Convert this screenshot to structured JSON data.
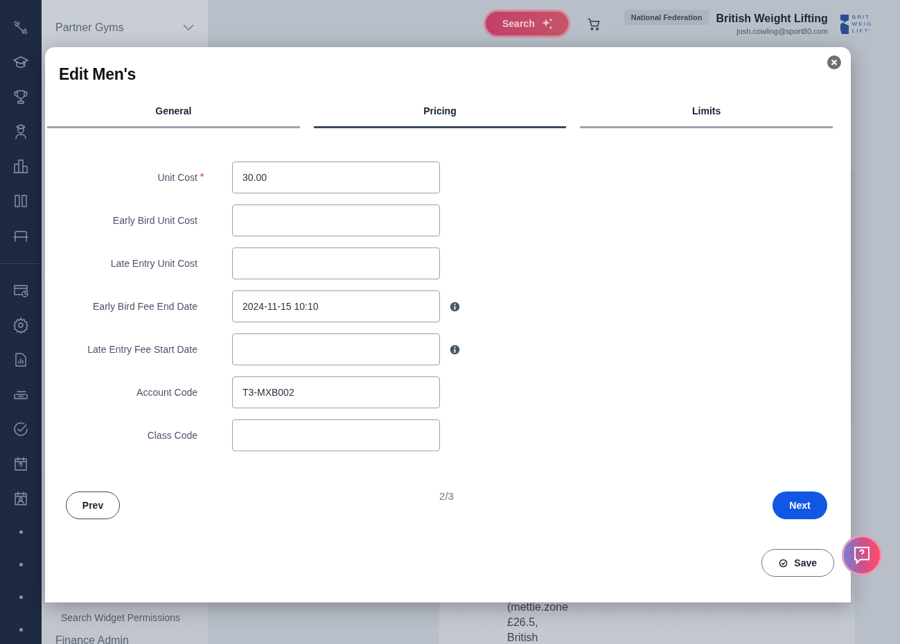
{
  "sidebar": {
    "top_item": "Partner Gyms",
    "items": [
      "Search Widget Permissions",
      "Finance Admin"
    ]
  },
  "header": {
    "search_button": "Search",
    "federation_badge": "National Federation",
    "organisation": "British Weight Lifting",
    "email": "josh.cowling@sport80.com",
    "logo_lines": [
      "BRIT",
      "WEIG",
      "LIFT'"
    ]
  },
  "background_card": {
    "lines": [
      "(mettie.zone",
      "£26.5,",
      "British"
    ]
  },
  "dialog": {
    "title": "Edit Men's",
    "tabs": [
      {
        "label": "General",
        "selected": false
      },
      {
        "label": "Pricing",
        "selected": true
      },
      {
        "label": "Limits",
        "selected": false
      }
    ],
    "fields": [
      {
        "label": "Unit Cost",
        "value": "30.00",
        "required": true,
        "info": false
      },
      {
        "label": "Early Bird Unit Cost",
        "required": false,
        "info": false
      },
      {
        "label": "Late Entry Unit Cost",
        "required": false,
        "info": false
      },
      {
        "label": "Early Bird Fee End Date",
        "value": "2024-11-15 10:10",
        "required": false,
        "info": true
      },
      {
        "label": "Late Entry Fee Start Date",
        "required": false,
        "info": true
      },
      {
        "label": "Account Code",
        "value": "T3-MXB002",
        "required": false,
        "info": false
      },
      {
        "label": "Class Code",
        "required": false,
        "info": false
      }
    ],
    "prev_button": "Prev",
    "page_indicator": "2/3",
    "next_button": "Next",
    "save_button": "Save"
  }
}
